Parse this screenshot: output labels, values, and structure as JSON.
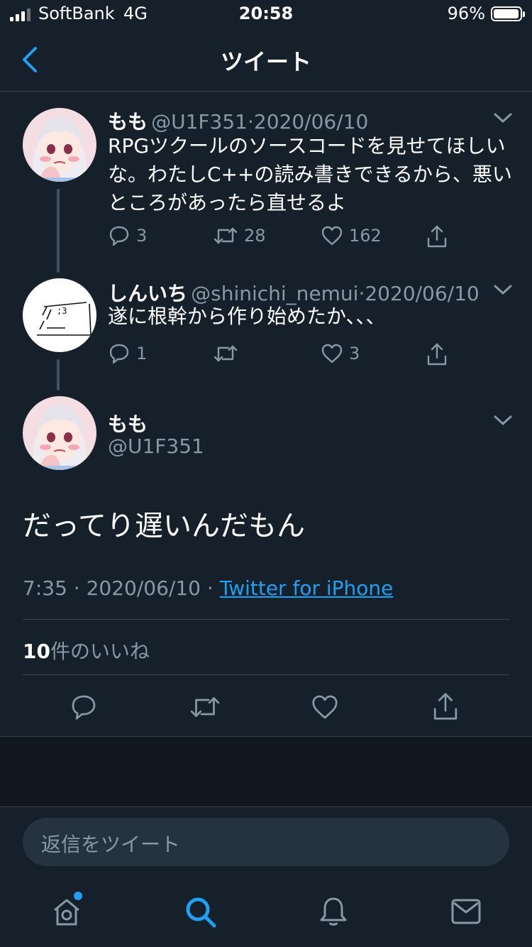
{
  "status_bar": {
    "carrier": "SoftBank",
    "network": "4G",
    "time": "20:58",
    "battery": "96%"
  },
  "nav": {
    "title": "ツイート"
  },
  "tweets": [
    {
      "name": "もも",
      "handle": "@U1F351",
      "date": "2020/06/10",
      "text_lines": [
        "RPGツクールのソースコードを見せてほしい",
        "な。わたしC++の読み書きできるから、悪い",
        "ところがあったら直せるよ"
      ],
      "replies": "3",
      "retweets": "28",
      "likes": "162"
    },
    {
      "name": "しんいち",
      "handle": "@shinichi_nemui",
      "date": "2020/06/10",
      "text": "遂に根幹から作り始めたか、、、",
      "replies": "1",
      "retweets": "",
      "likes": "3"
    }
  ],
  "main_tweet": {
    "name": "もも",
    "handle": "@U1F351",
    "text": "だってり遅いんだもん",
    "time": "7:35",
    "date": "2020/06/10",
    "separator": "·",
    "via": "Twitter for iPhone",
    "likes_count": "10",
    "likes_label": "件のいいね"
  },
  "reply": {
    "placeholder": "返信をツイート"
  },
  "colors": {
    "background": "#15202b",
    "accent": "#1da1f2",
    "muted": "#8899a6",
    "divider": "#38444d"
  },
  "icons": [
    "back-icon",
    "chevron-down-icon",
    "reply-icon",
    "retweet-icon",
    "like-icon",
    "share-icon",
    "home-icon",
    "search-icon",
    "notifications-icon",
    "messages-icon"
  ]
}
